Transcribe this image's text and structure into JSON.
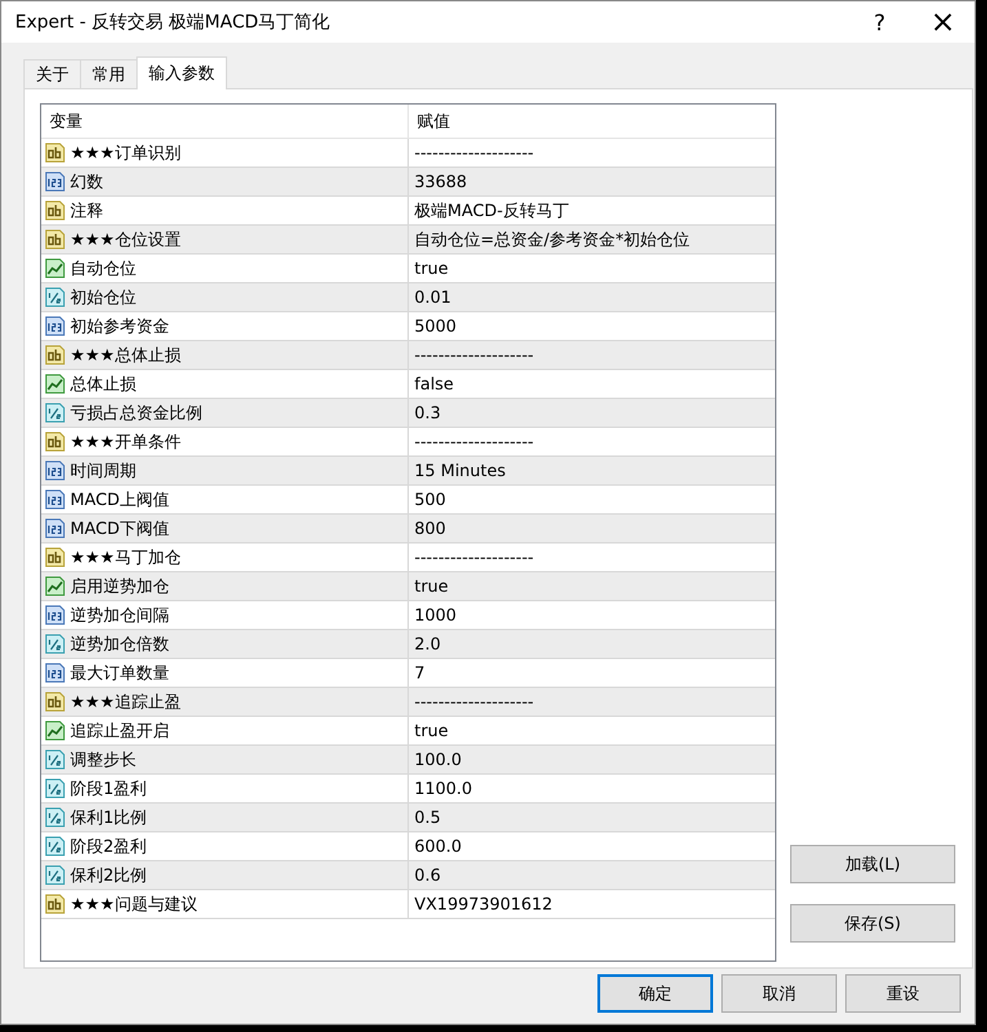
{
  "window": {
    "title": "Expert - 反转交易 极端MACD马丁简化",
    "help": "?",
    "close": "×"
  },
  "tabs": [
    {
      "label": "关于",
      "selected": false
    },
    {
      "label": "常用",
      "selected": false
    },
    {
      "label": "输入参数",
      "selected": true
    }
  ],
  "table": {
    "columns": [
      "变量",
      "赋值"
    ],
    "rows": [
      {
        "kind": "string",
        "name": "★★★订单识别",
        "value": "--------------------"
      },
      {
        "kind": "int",
        "name": "幻数",
        "value": "33688"
      },
      {
        "kind": "string",
        "name": "注释",
        "value": "极端MACD-反转马丁"
      },
      {
        "kind": "string",
        "name": "★★★仓位设置",
        "value": "自动仓位=总资金/参考资金*初始仓位"
      },
      {
        "kind": "bool",
        "name": "自动仓位",
        "value": "true"
      },
      {
        "kind": "double",
        "name": "初始仓位",
        "value": "0.01"
      },
      {
        "kind": "int",
        "name": "初始参考资金",
        "value": "5000"
      },
      {
        "kind": "string",
        "name": "★★★总体止损",
        "value": "--------------------"
      },
      {
        "kind": "bool",
        "name": "总体止损",
        "value": "false"
      },
      {
        "kind": "double",
        "name": "亏损占总资金比例",
        "value": "0.3"
      },
      {
        "kind": "string",
        "name": "★★★开单条件",
        "value": "--------------------"
      },
      {
        "kind": "int",
        "name": "时间周期",
        "value": "15 Minutes"
      },
      {
        "kind": "int",
        "name": "MACD上阀值",
        "value": "500"
      },
      {
        "kind": "int",
        "name": "MACD下阀值",
        "value": "800"
      },
      {
        "kind": "string",
        "name": "★★★马丁加仓",
        "value": "--------------------"
      },
      {
        "kind": "bool",
        "name": "启用逆势加仓",
        "value": "true"
      },
      {
        "kind": "int",
        "name": "逆势加仓间隔",
        "value": "1000"
      },
      {
        "kind": "double",
        "name": "逆势加仓倍数",
        "value": "2.0"
      },
      {
        "kind": "int",
        "name": "最大订单数量",
        "value": "7"
      },
      {
        "kind": "string",
        "name": "★★★追踪止盈",
        "value": "--------------------"
      },
      {
        "kind": "bool",
        "name": "追踪止盈开启",
        "value": "true"
      },
      {
        "kind": "double",
        "name": "调整步长",
        "value": "100.0"
      },
      {
        "kind": "double",
        "name": "阶段1盈利",
        "value": "1100.0"
      },
      {
        "kind": "double",
        "name": "保利1比例",
        "value": "0.5"
      },
      {
        "kind": "double",
        "name": "阶段2盈利",
        "value": "600.0"
      },
      {
        "kind": "double",
        "name": "保利2比例",
        "value": "0.6"
      },
      {
        "kind": "string",
        "name": "★★★问题与建议",
        "value": "VX19973901612"
      }
    ]
  },
  "side_buttons": [
    "加载(L)",
    "保存(S)"
  ],
  "buttons": [
    {
      "label": "确定",
      "default": true
    },
    {
      "label": "取消",
      "default": false
    },
    {
      "label": "重设",
      "default": false
    }
  ]
}
